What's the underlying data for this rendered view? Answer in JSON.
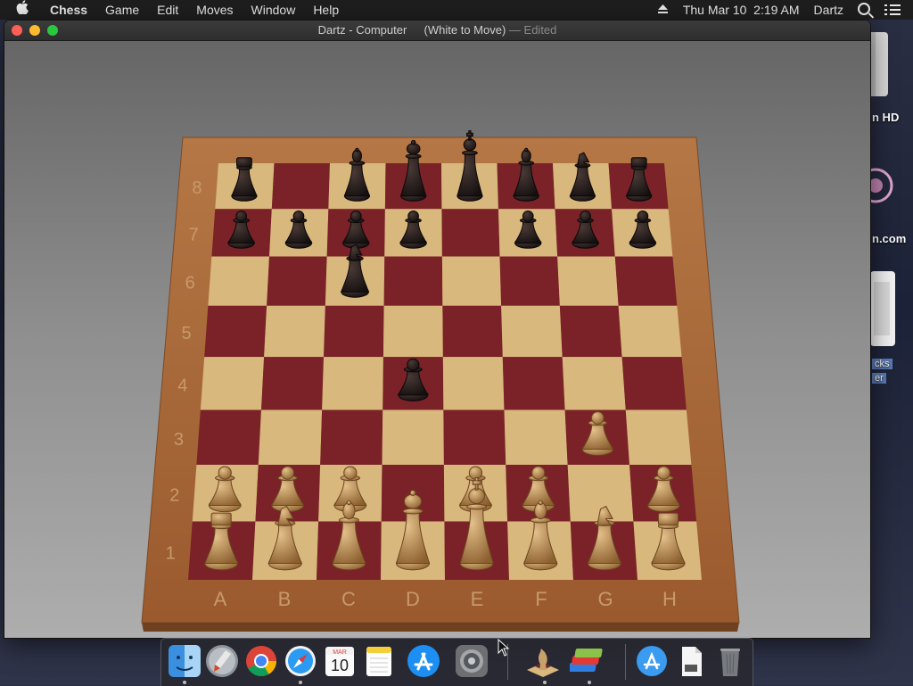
{
  "menubar": {
    "apple_icon": "",
    "items": [
      "Chess",
      "Game",
      "Edit",
      "Moves",
      "Window",
      "Help"
    ],
    "clock": "Thu Mar 10  2:19 AM",
    "user": "Dartz",
    "icons": [
      "eject-icon",
      "spotlight-search-icon",
      "notification-center-icon"
    ]
  },
  "desktop": {
    "labels": [
      "n HD",
      "n.com",
      "cks",
      "er"
    ]
  },
  "window": {
    "title": "Dartz - Computer",
    "subtitle": "(White to Move)",
    "edited": "— Edited"
  },
  "board": {
    "files": [
      "A",
      "B",
      "C",
      "D",
      "E",
      "F",
      "G",
      "H"
    ],
    "ranks": [
      "8",
      "7",
      "6",
      "5",
      "4",
      "3",
      "2",
      "1"
    ],
    "light_square": "#d9b87e",
    "dark_square": "#7a2228",
    "frame_color": "#a8683a",
    "pieces": [
      {
        "sq": "a8",
        "color": "black",
        "type": "rook"
      },
      {
        "sq": "c8",
        "color": "black",
        "type": "bishop"
      },
      {
        "sq": "d8",
        "color": "black",
        "type": "queen"
      },
      {
        "sq": "e8",
        "color": "black",
        "type": "king"
      },
      {
        "sq": "f8",
        "color": "black",
        "type": "bishop"
      },
      {
        "sq": "g8",
        "color": "black",
        "type": "knight"
      },
      {
        "sq": "h8",
        "color": "black",
        "type": "rook"
      },
      {
        "sq": "a7",
        "color": "black",
        "type": "pawn"
      },
      {
        "sq": "b7",
        "color": "black",
        "type": "pawn"
      },
      {
        "sq": "c7",
        "color": "black",
        "type": "pawn"
      },
      {
        "sq": "d7",
        "color": "black",
        "type": "pawn"
      },
      {
        "sq": "f7",
        "color": "black",
        "type": "pawn"
      },
      {
        "sq": "g7",
        "color": "black",
        "type": "pawn"
      },
      {
        "sq": "h7",
        "color": "black",
        "type": "pawn"
      },
      {
        "sq": "c6",
        "color": "black",
        "type": "knight"
      },
      {
        "sq": "d4",
        "color": "black",
        "type": "pawn"
      },
      {
        "sq": "g3",
        "color": "white",
        "type": "pawn"
      },
      {
        "sq": "a2",
        "color": "white",
        "type": "pawn"
      },
      {
        "sq": "b2",
        "color": "white",
        "type": "pawn"
      },
      {
        "sq": "c2",
        "color": "white",
        "type": "pawn"
      },
      {
        "sq": "e2",
        "color": "white",
        "type": "pawn"
      },
      {
        "sq": "f2",
        "color": "white",
        "type": "pawn"
      },
      {
        "sq": "h2",
        "color": "white",
        "type": "pawn"
      },
      {
        "sq": "a1",
        "color": "white",
        "type": "rook"
      },
      {
        "sq": "b1",
        "color": "white",
        "type": "knight"
      },
      {
        "sq": "c1",
        "color": "white",
        "type": "bishop"
      },
      {
        "sq": "d1",
        "color": "white",
        "type": "queen"
      },
      {
        "sq": "e1",
        "color": "white",
        "type": "king"
      },
      {
        "sq": "f1",
        "color": "white",
        "type": "bishop"
      },
      {
        "sq": "g1",
        "color": "white",
        "type": "knight"
      },
      {
        "sq": "h1",
        "color": "white",
        "type": "rook"
      }
    ]
  },
  "dock": {
    "calendar_month": "MAR",
    "calendar_day": "10",
    "items": [
      "finder-icon",
      "launchpad-icon",
      "chrome-icon",
      "safari-icon",
      "calendar-icon",
      "notes-icon",
      "app-store-icon",
      "system-preferences-icon",
      "chess-icon",
      "bluestacks-icon",
      "downloads-folder-icon",
      "document-icon",
      "trash-icon"
    ]
  }
}
